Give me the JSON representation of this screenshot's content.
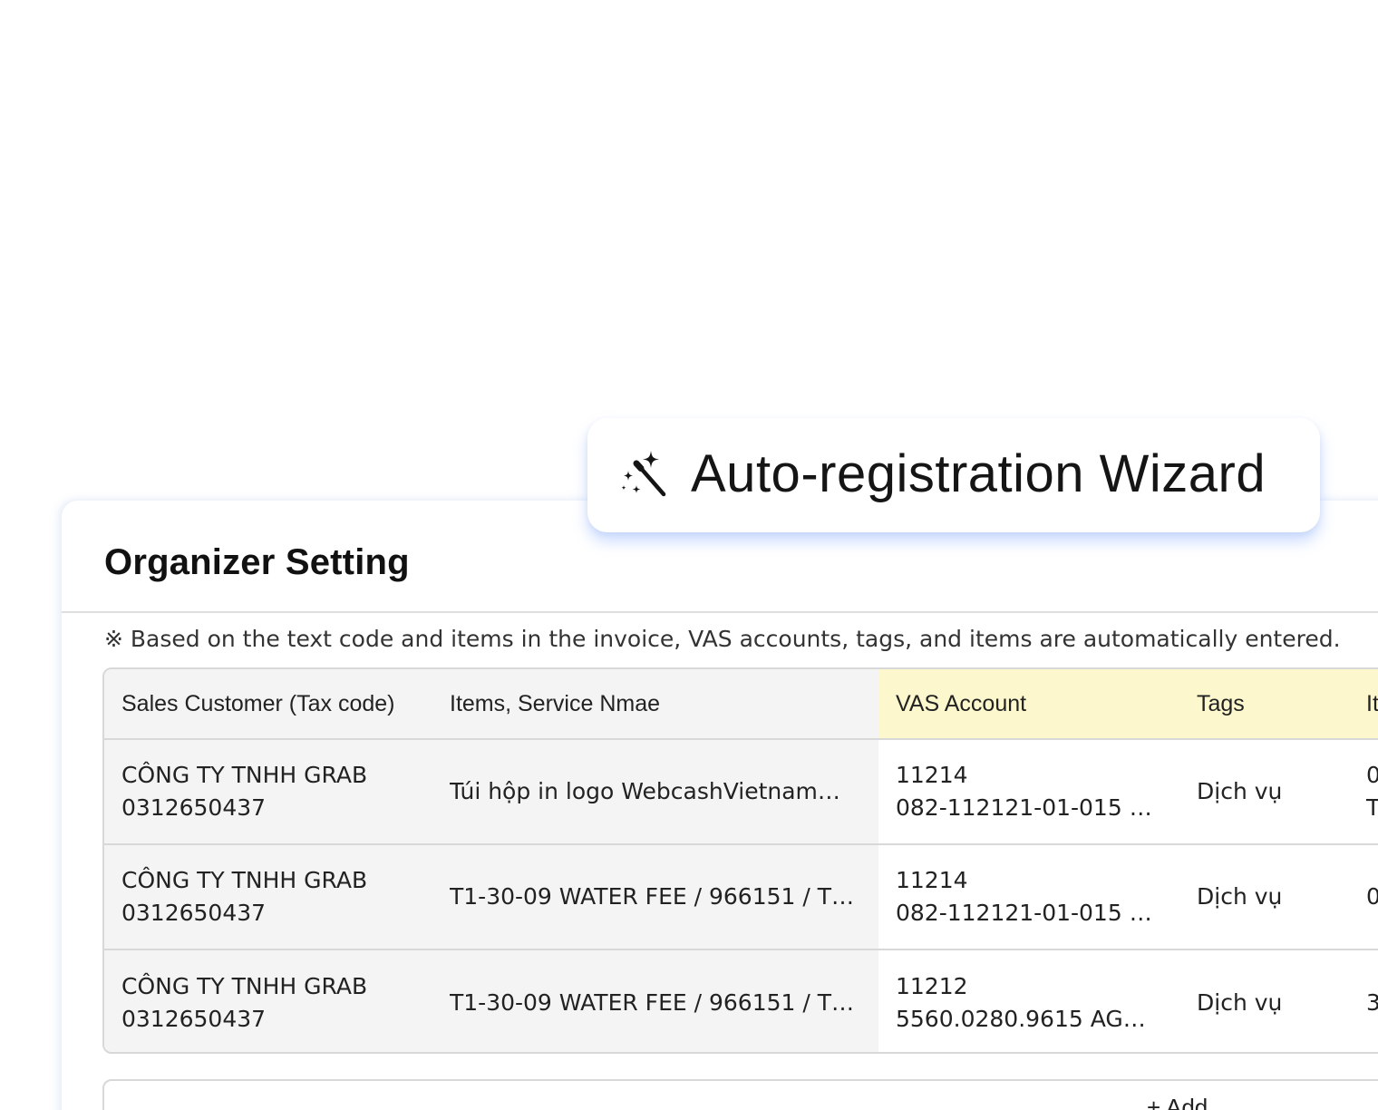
{
  "wizard": {
    "label": "Auto-registration Wizard",
    "icon": "magic-wand-sparkles-icon"
  },
  "panel": {
    "title": "Organizer Setting",
    "notice": "※ Based on the text code and items in the invoice, VAS accounts, tags, and items are automatically entered."
  },
  "table": {
    "headers": {
      "customer": "Sales Customer (Tax code)",
      "items": "Items, Service Nmae",
      "vas": "VAS Account",
      "tags": "Tags",
      "item2": "It"
    },
    "rows": [
      {
        "customer_name": "CÔNG TY TNHH GRAB",
        "tax_code": "0312650437",
        "item": "Túi hộp in logo WebcashVietnam…",
        "vas_code": "11214",
        "vas_detail": "082-112121-01-015 I…",
        "tag": "Dịch vụ",
        "item2_line1": "0",
        "item2_line2": "T"
      },
      {
        "customer_name": "CÔNG TY TNHH GRAB",
        "tax_code": "0312650437",
        "item": "T1-30-09 WATER FEE / 966151 / T…",
        "vas_code": "11214",
        "vas_detail": "082-112121-01-015 I…",
        "tag": "Dịch vụ",
        "item2_line1": "0",
        "item2_line2": ""
      },
      {
        "customer_name": "CÔNG TY TNHH GRAB",
        "tax_code": "0312650437",
        "item": "T1-30-09 WATER FEE / 966151 / T…",
        "vas_code": "11212",
        "vas_detail": "5560.0280.9615 AG…",
        "tag": "Dịch vụ",
        "item2_line1": "3",
        "item2_line2": ""
      }
    ]
  },
  "add_button": {
    "label": "+ Add"
  },
  "colors": {
    "header_highlight": "#fcf7cc",
    "wizard_glow": "#8cafff",
    "cell_gray": "#f4f4f4"
  }
}
